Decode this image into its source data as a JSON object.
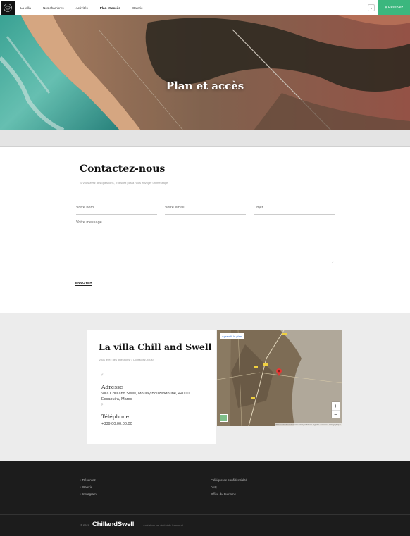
{
  "nav": {
    "items": [
      {
        "label": "La Villa",
        "active": false
      },
      {
        "label": "Nos chambres",
        "active": false
      },
      {
        "label": "Activités",
        "active": false
      },
      {
        "label": "Plan et accès",
        "active": true
      },
      {
        "label": "Galerie",
        "active": false
      }
    ],
    "lang": "fr",
    "reserve_label": "Réservez"
  },
  "hero": {
    "title": "Plan et accès"
  },
  "contact": {
    "title": "Contactez-nous",
    "subtitle": "Si vous avez des questions, n'hésitez pas à nous envoyer un message.",
    "name_placeholder": "Votre nom",
    "email_placeholder": "Votre email",
    "subject_placeholder": "Objet",
    "message_placeholder": "Votre message",
    "send_label": "ENVOYER"
  },
  "location": {
    "title": "La villa Chill and Swell",
    "question": "Vous avez des questions ? Contactez-nous!",
    "address_label": "Adresse",
    "address_line1": "Villa Chill and Swell, Moulay Bouzerktoune, 44000,",
    "address_line2": "Essaouira, Maroc",
    "phone_label": "Téléphone",
    "phone_value": "+339.00.00.00.00",
    "map_link": "Agrandir le plan",
    "map_footer": "Raccourcis clavier   Données cartographiques   Signaler une erreur cartographique"
  },
  "footer": {
    "links_left": [
      "Réservez",
      "Galerie",
      "Instagram"
    ],
    "links_right": [
      "Politique de confidentialité",
      "FAQ",
      "Office du tourisme"
    ],
    "copyright": "© 2021",
    "brand": "ChillandSwell",
    "credit": "- création par Adélaïde Leonardi"
  },
  "colors": {
    "accent": "#3bb77e",
    "footer_bg": "#1c1c1c"
  }
}
